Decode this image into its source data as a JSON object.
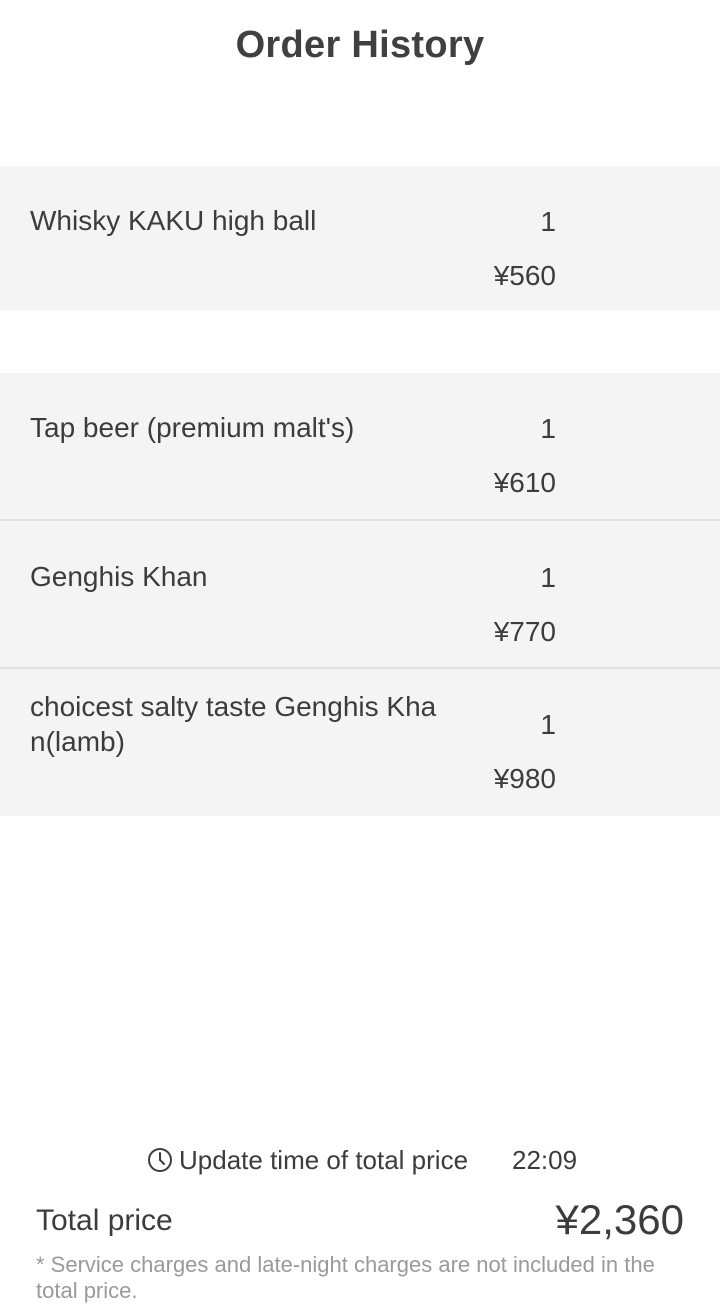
{
  "header": {
    "title": "Order History"
  },
  "orders": [
    {
      "items": [
        {
          "name": "Whisky KAKU high ball",
          "qty": "1",
          "price": "¥560"
        }
      ]
    },
    {
      "items": [
        {
          "name": "Tap beer (premium malt's)",
          "qty": "1",
          "price": "¥610"
        },
        {
          "name": "Genghis Khan",
          "qty": "1",
          "price": "¥770"
        },
        {
          "name": "choicest salty taste Genghis Khan(lamb)",
          "qty": "1",
          "price": "¥980"
        }
      ]
    }
  ],
  "footer": {
    "update_label": "Update time of total price",
    "update_icon": "clock-icon",
    "update_time": "22:09",
    "total_label": "Total price",
    "total_value": "¥2,360",
    "note": "* Service charges and late-night charges are not included in the total price."
  },
  "colors": {
    "background": "#ffffff",
    "item_background": "#f4f4f4",
    "divider": "#e2e2e2",
    "text": "#3c3c3c",
    "note_text": "#9a9a9a"
  }
}
